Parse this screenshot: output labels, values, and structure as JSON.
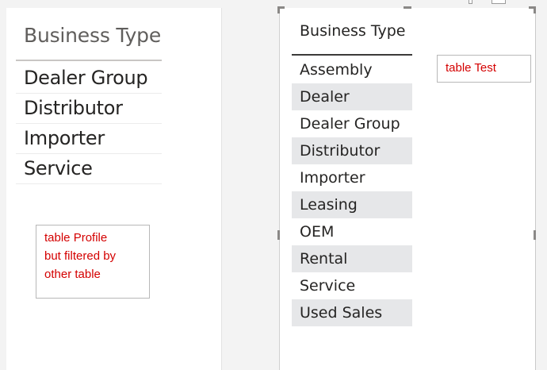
{
  "left_slicer": {
    "header": "Business Type",
    "items": [
      "Dealer Group",
      "Distributor",
      "Importer",
      "Service"
    ]
  },
  "left_note": {
    "lines": [
      "table Profile",
      "but filtered by",
      "other table"
    ]
  },
  "right_table": {
    "header": "Business Type",
    "items": [
      "Assembly",
      "Dealer",
      "Dealer Group",
      "Distributor",
      "Importer",
      "Leasing",
      "OEM",
      "Rental",
      "Service",
      "Used Sales"
    ]
  },
  "right_note": {
    "text": "table Test"
  },
  "colors": {
    "note_text": "#d40000",
    "alt_row": "#e6e7e9"
  }
}
